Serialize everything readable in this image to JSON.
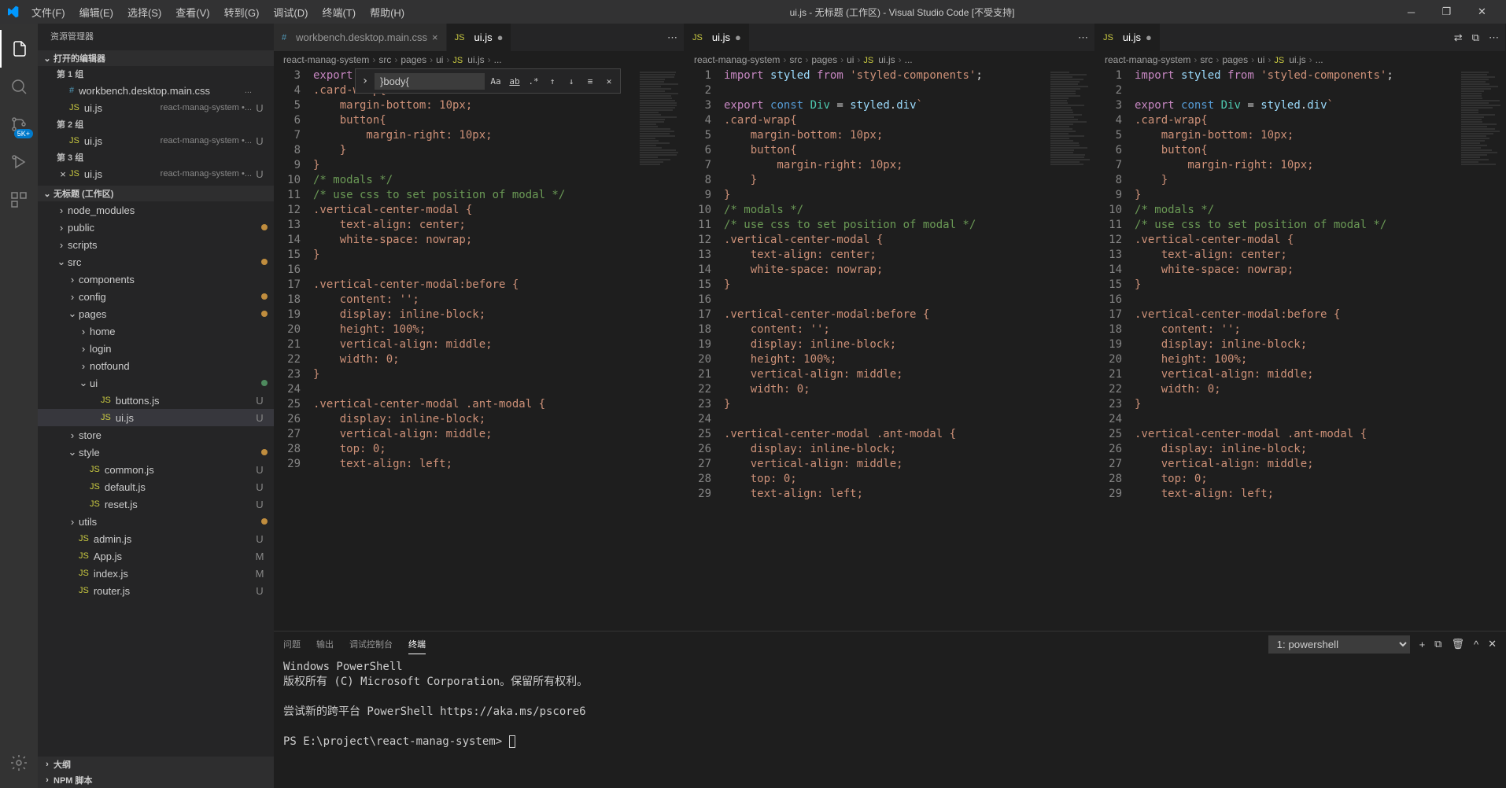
{
  "titlebar": {
    "menus": [
      "文件(F)",
      "编辑(E)",
      "选择(S)",
      "查看(V)",
      "转到(G)",
      "调试(D)",
      "终端(T)",
      "帮助(H)"
    ],
    "title": "ui.js - 无标题 (工作区) - Visual Studio Code [不受支持]"
  },
  "activitybar": {
    "badge": "5K+"
  },
  "sidebar": {
    "title": "资源管理器",
    "sections": {
      "openEditors": "打开的编辑器",
      "group1": "第 1 组",
      "group2": "第 2 组",
      "group3": "第 3 组",
      "workspace": "无标题 (工作区)",
      "outline": "大纲",
      "npm": "NPM 脚本"
    },
    "openFiles": [
      {
        "icon": "css",
        "name": "workbench.desktop.main.css",
        "desc": "...",
        "group": 1,
        "status": ""
      },
      {
        "icon": "js",
        "name": "ui.js",
        "desc": "react-manag-system •...",
        "group": 1,
        "status": "U"
      },
      {
        "icon": "js",
        "name": "ui.js",
        "desc": "react-manag-system •...",
        "group": 2,
        "status": "U"
      },
      {
        "icon": "js",
        "name": "ui.js",
        "desc": "react-manag-system •...",
        "group": 3,
        "status": "U",
        "close": true
      }
    ],
    "tree": [
      {
        "indent": 1,
        "chev": ">",
        "name": "node_modules",
        "type": "folder",
        "dot": ""
      },
      {
        "indent": 1,
        "chev": ">",
        "name": "public",
        "type": "folder",
        "dot": "m"
      },
      {
        "indent": 1,
        "chev": ">",
        "name": "scripts",
        "type": "folder",
        "dot": ""
      },
      {
        "indent": 1,
        "chev": "v",
        "name": "src",
        "type": "folder",
        "dot": "m"
      },
      {
        "indent": 2,
        "chev": ">",
        "name": "components",
        "type": "folder",
        "dot": ""
      },
      {
        "indent": 2,
        "chev": ">",
        "name": "config",
        "type": "folder",
        "dot": "m"
      },
      {
        "indent": 2,
        "chev": "v",
        "name": "pages",
        "type": "folder",
        "dot": "m"
      },
      {
        "indent": 3,
        "chev": ">",
        "name": "home",
        "type": "folder",
        "dot": ""
      },
      {
        "indent": 3,
        "chev": ">",
        "name": "login",
        "type": "folder",
        "dot": ""
      },
      {
        "indent": 3,
        "chev": ">",
        "name": "notfound",
        "type": "folder",
        "dot": ""
      },
      {
        "indent": 3,
        "chev": "v",
        "name": "ui",
        "type": "folder",
        "dot": "u"
      },
      {
        "indent": 4,
        "chev": "",
        "name": "buttons.js",
        "type": "js",
        "status": "U"
      },
      {
        "indent": 4,
        "chev": "",
        "name": "ui.js",
        "type": "js",
        "status": "U",
        "selected": true
      },
      {
        "indent": 2,
        "chev": ">",
        "name": "store",
        "type": "folder",
        "dot": ""
      },
      {
        "indent": 2,
        "chev": "v",
        "name": "style",
        "type": "folder",
        "dot": "m"
      },
      {
        "indent": 3,
        "chev": "",
        "name": "common.js",
        "type": "js",
        "status": "U"
      },
      {
        "indent": 3,
        "chev": "",
        "name": "default.js",
        "type": "js",
        "status": "U"
      },
      {
        "indent": 3,
        "chev": "",
        "name": "reset.js",
        "type": "js",
        "status": "U"
      },
      {
        "indent": 2,
        "chev": ">",
        "name": "utils",
        "type": "folder",
        "dot": "m"
      },
      {
        "indent": 2,
        "chev": "",
        "name": "admin.js",
        "type": "js",
        "status": "U"
      },
      {
        "indent": 2,
        "chev": "",
        "name": "App.js",
        "type": "js",
        "status": "M"
      },
      {
        "indent": 2,
        "chev": "",
        "name": "index.js",
        "type": "js",
        "status": "M"
      },
      {
        "indent": 2,
        "chev": "",
        "name": "router.js",
        "type": "js",
        "status": "U"
      }
    ]
  },
  "editorGroups": [
    {
      "tabs": [
        {
          "icon": "css",
          "label": "workbench.desktop.main.css",
          "active": false
        },
        {
          "icon": "js",
          "label": "ui.js",
          "active": true,
          "status": "●"
        }
      ],
      "breadcrumb": [
        "react-manag-system",
        "src",
        "pages",
        "ui",
        "ui.js",
        "..."
      ],
      "findValue": "}body{",
      "startLine": 3
    },
    {
      "tabs": [
        {
          "icon": "js",
          "label": "ui.js",
          "active": true,
          "status": "●"
        }
      ],
      "breadcrumb": [
        "react-manag-system",
        "src",
        "pages",
        "ui",
        "ui.js",
        "..."
      ],
      "startLine": 1
    },
    {
      "tabs": [
        {
          "icon": "js",
          "label": "ui.js",
          "active": true,
          "status": "●"
        }
      ],
      "breadcrumb": [
        "react-manag-system",
        "src",
        "pages",
        "ui",
        "ui.js",
        "..."
      ],
      "startLine": 1
    }
  ],
  "code": [
    {
      "n": 1,
      "html": "<span class='kw'>import</span> <span class='prop'>styled</span> <span class='kw'>from</span> <span class='str'>'styled-components'</span>;"
    },
    {
      "n": 2,
      "html": ""
    },
    {
      "n": 3,
      "html": "<span class='kw'>export</span> <span class='kw2'>const</span> <span class='type'>Div</span> = <span class='prop'>styled</span>.<span class='prop'>div</span><span class='str'>`</span>"
    },
    {
      "n": 4,
      "html": "<span class='str'>.card-wrap{</span>"
    },
    {
      "n": 5,
      "html": "<span class='str'>    margin-bottom: 10px;</span>"
    },
    {
      "n": 6,
      "html": "<span class='str'>    button{</span>"
    },
    {
      "n": 7,
      "html": "<span class='str'>        margin-right: 10px;</span>"
    },
    {
      "n": 8,
      "html": "<span class='str'>    }</span>"
    },
    {
      "n": 9,
      "html": "<span class='str'>}</span>"
    },
    {
      "n": 10,
      "html": "<span class='com'>/* modals */</span>"
    },
    {
      "n": 11,
      "html": "<span class='com'>/* use css to set position of modal */</span>"
    },
    {
      "n": 12,
      "html": "<span class='str'>.vertical-center-modal {</span>"
    },
    {
      "n": 13,
      "html": "<span class='str'>    text-align: center;</span>"
    },
    {
      "n": 14,
      "html": "<span class='str'>    white-space: nowrap;</span>"
    },
    {
      "n": 15,
      "html": "<span class='str'>}</span>"
    },
    {
      "n": 16,
      "html": ""
    },
    {
      "n": 17,
      "html": "<span class='str'>.vertical-center-modal:before {</span>"
    },
    {
      "n": 18,
      "html": "<span class='str'>    content: '';</span>"
    },
    {
      "n": 19,
      "html": "<span class='str'>    display: inline-block;</span>"
    },
    {
      "n": 20,
      "html": "<span class='str'>    height: 100%;</span>"
    },
    {
      "n": 21,
      "html": "<span class='str'>    vertical-align: middle;</span>"
    },
    {
      "n": 22,
      "html": "<span class='str'>    width: 0;</span>"
    },
    {
      "n": 23,
      "html": "<span class='str'>}</span>"
    },
    {
      "n": 24,
      "html": ""
    },
    {
      "n": 25,
      "html": "<span class='str'>.vertical-center-modal .ant-modal {</span>"
    },
    {
      "n": 26,
      "html": "<span class='str'>    display: inline-block;</span>"
    },
    {
      "n": 27,
      "html": "<span class='str'>    vertical-align: middle;</span>"
    },
    {
      "n": 28,
      "html": "<span class='str'>    top: 0;</span>"
    },
    {
      "n": 29,
      "html": "<span class='str'>    text-align: left;</span>"
    }
  ],
  "panel": {
    "tabs": [
      "问题",
      "输出",
      "调试控制台",
      "终端"
    ],
    "activeTab": 3,
    "dropdown": "1: powershell",
    "terminal": [
      "Windows PowerShell",
      "版权所有 (C) Microsoft Corporation。保留所有权利。",
      "",
      "尝试新的跨平台 PowerShell https://aka.ms/pscore6",
      "",
      "PS E:\\project\\react-manag-system> "
    ]
  }
}
